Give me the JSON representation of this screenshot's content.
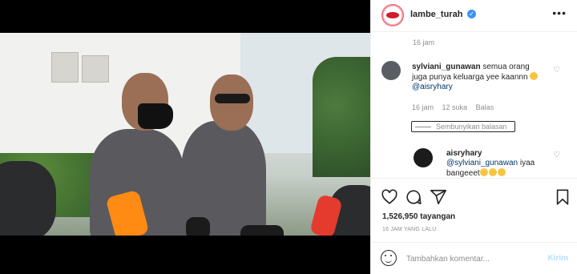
{
  "account": {
    "username": "lambe_turah",
    "verified_icon": "verified-badge-icon"
  },
  "menu_icon": "more-options-icon",
  "comments_panel": {
    "top_timestamp": "16 jam",
    "comment": {
      "username": "sylviani_gunawan",
      "text": "semua orang juga punya keluarga yee kaannn",
      "mention": "@aisryhary",
      "time": "16 jam",
      "likes": "12 suka",
      "reply_label": "Balas"
    },
    "hide_replies_label": "Sembunyikan balasan",
    "reply": {
      "username": "aisryhary",
      "mention": "@sylviani_gunawan",
      "text": "iyaa bangeeet"
    }
  },
  "actions": {
    "like_icon": "heart-icon",
    "comment_icon": "comment-icon",
    "share_icon": "paper-plane-icon",
    "save_icon": "bookmark-icon"
  },
  "views": "1,526,950 tayangan",
  "posted_ago": "16 JAM YANG LALU",
  "add_comment": {
    "placeholder": "Tambahkan komentar...",
    "submit_label": "Kirim",
    "emoji_icon": "emoji-icon"
  },
  "video": {
    "sound_icon": "speaker-icon"
  },
  "colors": {
    "accent": "#3897f0",
    "muted": "#8e8e8e",
    "submit_disabled": "#b2dffc"
  }
}
